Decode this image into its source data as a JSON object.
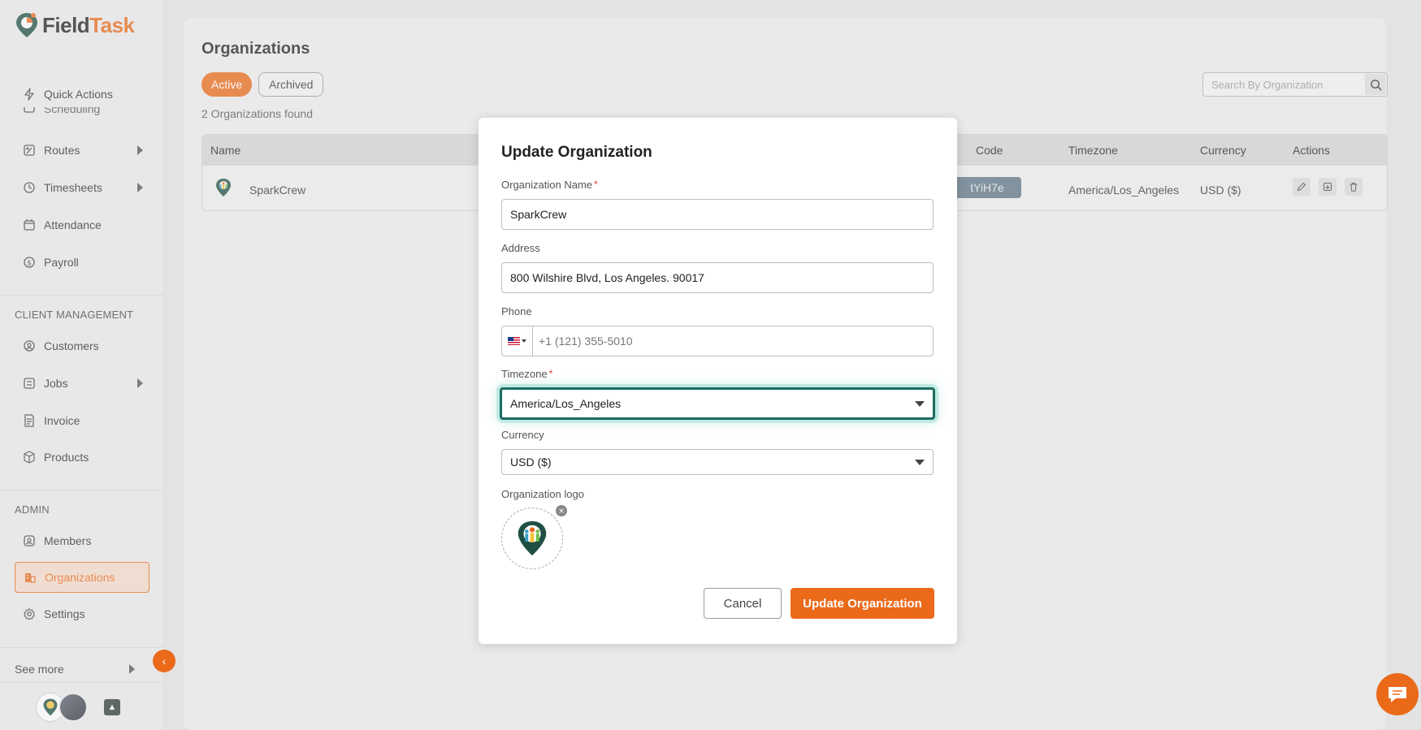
{
  "app": {
    "name_prefix": "Field",
    "name_suffix": "Task"
  },
  "sidebar": {
    "items_top": [
      {
        "label": "Quick Actions",
        "icon": "bolt-icon"
      },
      {
        "label": "Scheduling",
        "icon": "calendar-icon"
      },
      {
        "label": "Routes",
        "icon": "route-icon"
      },
      {
        "label": "Timesheets",
        "icon": "clock-icon"
      },
      {
        "label": "Attendance",
        "icon": "calendar-check-icon"
      },
      {
        "label": "Payroll",
        "icon": "dollar-icon"
      }
    ],
    "client_section": "CLIENT MANAGEMENT",
    "items_client": [
      {
        "label": "Customers",
        "icon": "user-circle-icon"
      },
      {
        "label": "Jobs",
        "icon": "list-icon"
      },
      {
        "label": "Invoice",
        "icon": "invoice-icon"
      },
      {
        "label": "Products",
        "icon": "box-icon"
      }
    ],
    "admin_section": "ADMIN",
    "items_admin": [
      {
        "label": "Members",
        "icon": "user-square-icon"
      },
      {
        "label": "Organizations",
        "icon": "building-icon"
      },
      {
        "label": "Settings",
        "icon": "gear-icon"
      }
    ],
    "see_more": "See more"
  },
  "page": {
    "title": "Organizations",
    "tabs": {
      "active": "Active",
      "archived": "Archived"
    },
    "found": "2 Organizations found",
    "search_placeholder": "Search By Organization"
  },
  "table": {
    "headers": {
      "name": "Name",
      "code": "Code",
      "timezone": "Timezone",
      "currency": "Currency",
      "actions": "Actions"
    },
    "rows": [
      {
        "name": "SparkCrew",
        "code": "tYiH7e",
        "timezone": "America/Los_Angeles",
        "currency": "USD ($)"
      }
    ]
  },
  "modal": {
    "title": "Update Organization",
    "org_name_label": "Organization Name",
    "org_name_value": "SparkCrew",
    "address_label": "Address",
    "address_value": "800 Wilshire Blvd, Los Angeles. 90017",
    "phone_label": "Phone",
    "phone_placeholder": "+1 (121) 355-5010",
    "timezone_label": "Timezone",
    "timezone_value": "America/Los_Angeles",
    "currency_label": "Currency",
    "currency_value": "USD ($)",
    "logo_label": "Organization logo",
    "required_mark": "*",
    "remove_symbol": "×",
    "cancel": "Cancel",
    "submit": "Update Organization"
  },
  "colors": {
    "accent": "#ea6a1a",
    "focus": "#1d6b60",
    "code_badge": "#5e7585"
  }
}
